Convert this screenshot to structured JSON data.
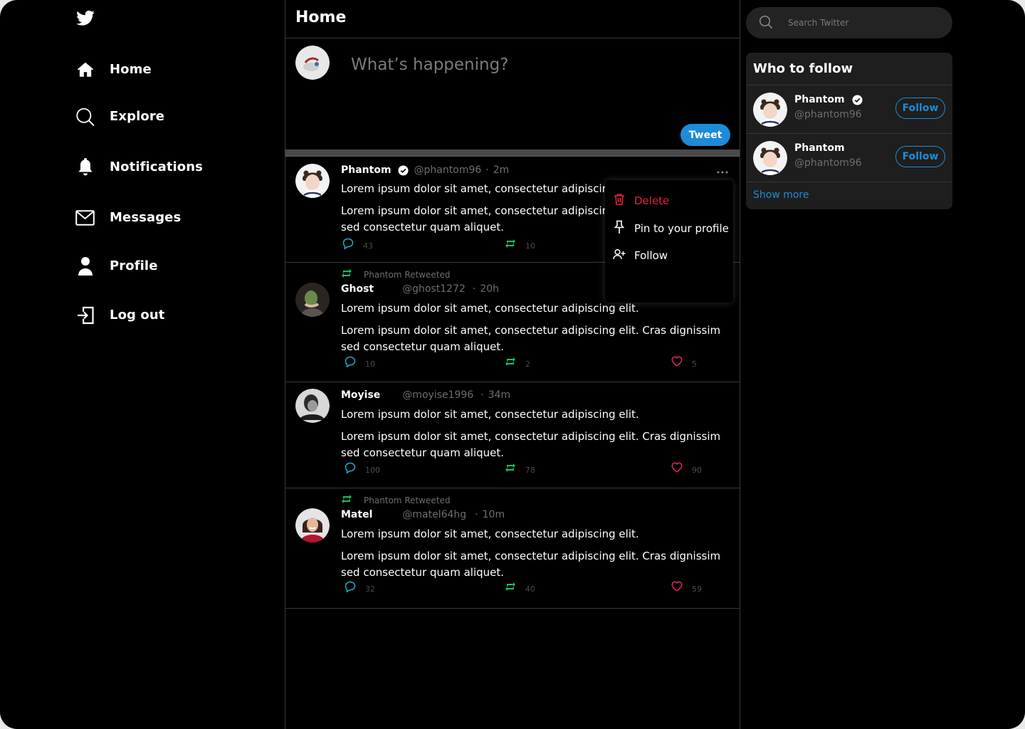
{
  "sidebar": {
    "items": [
      {
        "label": "Home",
        "icon": "home-icon"
      },
      {
        "label": "Explore",
        "icon": "search-icon"
      },
      {
        "label": "Notifications",
        "icon": "bell-icon"
      },
      {
        "label": "Messages",
        "icon": "mail-icon"
      },
      {
        "label": "Profile",
        "icon": "person-icon"
      },
      {
        "label": "Log out",
        "icon": "logout-icon"
      }
    ]
  },
  "feed": {
    "title": "Home",
    "composer": {
      "placeholder": "What’s happening?",
      "tweet_label": "Tweet"
    },
    "tweets": [
      {
        "name": "Phantom",
        "verified": true,
        "handle": "@phantom96",
        "dot": "·",
        "time": "2m",
        "line1": "Lorem ipsum dolor sit amet, consectetur adipiscing elit.",
        "line2": "Lorem ipsum dolor sit amet, consectetur adipiscing elit. Cras dignissim sed consectetur quam aliquet.",
        "replies": "43",
        "retweets": "10",
        "likes": ""
      },
      {
        "retweet_label": "Phantom Retweeted",
        "name": "Ghost",
        "handle": "@ghost1272",
        "dot": "·",
        "time": "20h",
        "line1": "Lorem ipsum dolor sit amet, consectetur adipiscing elit.",
        "line2": "Lorem ipsum dolor sit amet, consectetur adipiscing elit. Cras dignissim sed consectetur quam aliquet.",
        "replies": "10",
        "retweets": "2",
        "likes": "5"
      },
      {
        "name": "Moyise",
        "handle": "@moyise1996",
        "dot": "·",
        "time": "34m",
        "line1": "Lorem ipsum dolor sit amet, consectetur adipiscing elit.",
        "line2": "Lorem ipsum dolor sit amet, consectetur adipiscing elit. Cras dignissim sed consectetur quam aliquet.",
        "replies": "100",
        "retweets": "78",
        "likes": "90"
      },
      {
        "retweet_label": "Phantom Retweeted",
        "name": "Matel",
        "handle": "@matel64hg",
        "dot": "·",
        "time": "10m",
        "line1": "Lorem ipsum dolor sit amet, consectetur adipiscing elit.",
        "line2": "Lorem ipsum dolor sit amet, consectetur adipiscing elit. Cras dignissim sed consectetur quam aliquet.",
        "replies": "32",
        "retweets": "40",
        "likes": "59"
      }
    ]
  },
  "context_menu": {
    "items": [
      {
        "label": "Delete",
        "icon": "trash-icon"
      },
      {
        "label": "Pin to your profile",
        "icon": "pin-icon"
      },
      {
        "label": "Follow",
        "icon": "add-user-icon"
      }
    ]
  },
  "search": {
    "placeholder": "Search Twitter"
  },
  "who_to_follow": {
    "title": "Who to follow",
    "accounts": [
      {
        "name": "Phantom",
        "verified": true,
        "handle": "@phantom96",
        "button": "Follow"
      },
      {
        "name": "Phantom",
        "verified": false,
        "handle": "@phantom96",
        "button": "Follow"
      }
    ],
    "show_more": "Show more"
  },
  "colors": {
    "background": "#000000",
    "accent": "#1d8cd8",
    "reply": "#1fb0c9",
    "retweet": "#17bf63",
    "like": "#e0245e",
    "delete": "#e0243f"
  }
}
